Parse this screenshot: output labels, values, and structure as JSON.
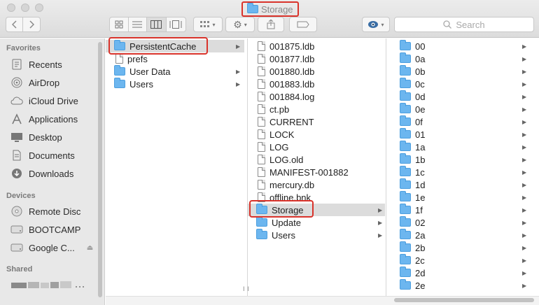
{
  "window": {
    "title": "Storage"
  },
  "toolbar": {
    "back_icon": "chevron-left-icon",
    "forward_icon": "chevron-right-icon",
    "search_placeholder": "Search"
  },
  "sidebar": {
    "favorites_header": "Favorites",
    "favorites": [
      {
        "label": "Recents",
        "icon": "clock-icon"
      },
      {
        "label": "AirDrop",
        "icon": "airdrop-icon"
      },
      {
        "label": "iCloud Drive",
        "icon": "cloud-icon"
      },
      {
        "label": "Applications",
        "icon": "applications-icon"
      },
      {
        "label": "Desktop",
        "icon": "desktop-icon"
      },
      {
        "label": "Documents",
        "icon": "document-icon"
      },
      {
        "label": "Downloads",
        "icon": "download-icon"
      }
    ],
    "devices_header": "Devices",
    "devices": [
      {
        "label": "Remote Disc",
        "icon": "disc-icon"
      },
      {
        "label": "BOOTCAMP",
        "icon": "drive-icon"
      },
      {
        "label": "Google C...",
        "icon": "drive-icon"
      }
    ],
    "shared_header": "Shared"
  },
  "column1": [
    {
      "name": "PersistentCache",
      "type": "folder",
      "arrow": true
    },
    {
      "name": "prefs",
      "type": "file",
      "arrow": false
    },
    {
      "name": "User Data",
      "type": "folder",
      "arrow": true
    },
    {
      "name": "Users",
      "type": "folder",
      "arrow": true
    }
  ],
  "column2": [
    {
      "name": "001875.ldb",
      "type": "file"
    },
    {
      "name": "001877.ldb",
      "type": "file"
    },
    {
      "name": "001880.ldb",
      "type": "file"
    },
    {
      "name": "001883.ldb",
      "type": "file"
    },
    {
      "name": "001884.log",
      "type": "file"
    },
    {
      "name": "ct.pb",
      "type": "file"
    },
    {
      "name": "CURRENT",
      "type": "file"
    },
    {
      "name": "LOCK",
      "type": "file"
    },
    {
      "name": "LOG",
      "type": "file"
    },
    {
      "name": "LOG.old",
      "type": "file"
    },
    {
      "name": "MANIFEST-001882",
      "type": "file"
    },
    {
      "name": "mercury.db",
      "type": "file"
    },
    {
      "name": "offline.bnk",
      "type": "file"
    },
    {
      "name": "Storage",
      "type": "folder",
      "arrow": true
    },
    {
      "name": "Update",
      "type": "folder",
      "arrow": true
    },
    {
      "name": "Users",
      "type": "folder",
      "arrow": true
    }
  ],
  "column3": [
    "00",
    "0a",
    "0b",
    "0c",
    "0d",
    "0e",
    "0f",
    "01",
    "1a",
    "1b",
    "1c",
    "1d",
    "1e",
    "1f",
    "02",
    "2a",
    "2b",
    "2c",
    "2d",
    "2e"
  ]
}
